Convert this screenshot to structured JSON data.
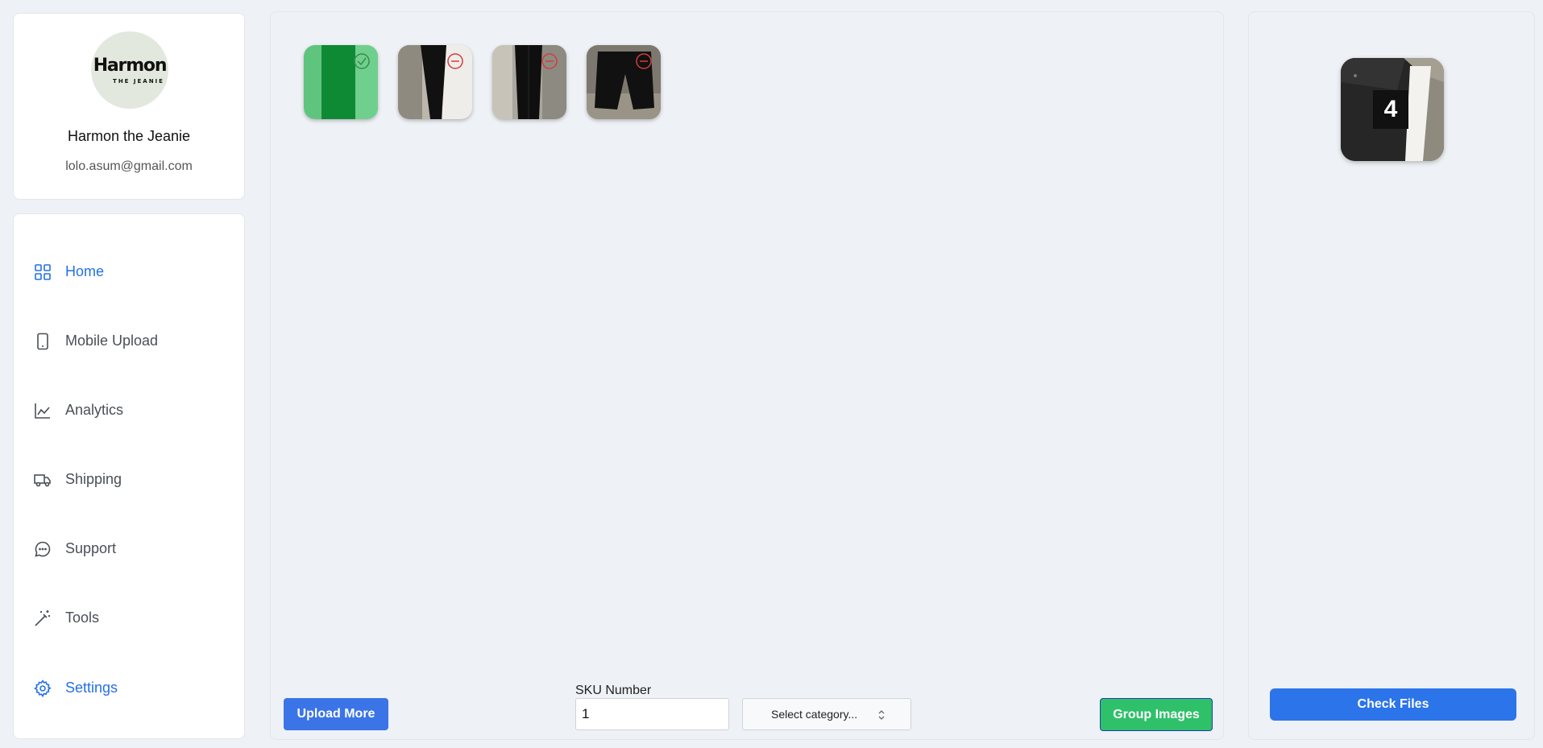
{
  "profile": {
    "logo_main": "Harmon",
    "logo_sub": "THE JEANIE",
    "name": "Harmon the Jeanie",
    "email": "lolo.asum@gmail.com"
  },
  "nav": {
    "items": [
      {
        "label": "Home",
        "icon": "grid-icon",
        "active": true
      },
      {
        "label": "Mobile Upload",
        "icon": "phone-icon",
        "active": false
      },
      {
        "label": "Analytics",
        "icon": "chart-icon",
        "active": false
      },
      {
        "label": "Shipping",
        "icon": "truck-icon",
        "active": false
      },
      {
        "label": "Support",
        "icon": "chat-icon",
        "active": false
      },
      {
        "label": "Tools",
        "icon": "magic-wand-icon",
        "active": false
      },
      {
        "label": "Settings",
        "icon": "gear-icon",
        "active": true
      }
    ]
  },
  "main": {
    "thumbnails": [
      {
        "subject": "green fabric",
        "badge": "check-circle-icon",
        "badge_color": "#3a8a4a"
      },
      {
        "subject": "black jeans",
        "badge": "minus-circle-icon",
        "badge_color": "#d43c3c"
      },
      {
        "subject": "black jeans",
        "badge": "minus-circle-icon",
        "badge_color": "#d43c3c"
      },
      {
        "subject": "black jeans",
        "badge": "minus-circle-icon",
        "badge_color": "#d43c3c"
      }
    ],
    "upload_more_label": "Upload More",
    "sku_label": "SKU Number",
    "sku_value": "1",
    "category_placeholder": "Select category...",
    "group_images_label": "Group Images"
  },
  "right": {
    "group_count": "4",
    "check_files_label": "Check Files"
  },
  "colors": {
    "accent": "#2471e3",
    "primary_button": "#3b74e6",
    "success_button": "#2fc06a",
    "background": "#eef1f5"
  }
}
